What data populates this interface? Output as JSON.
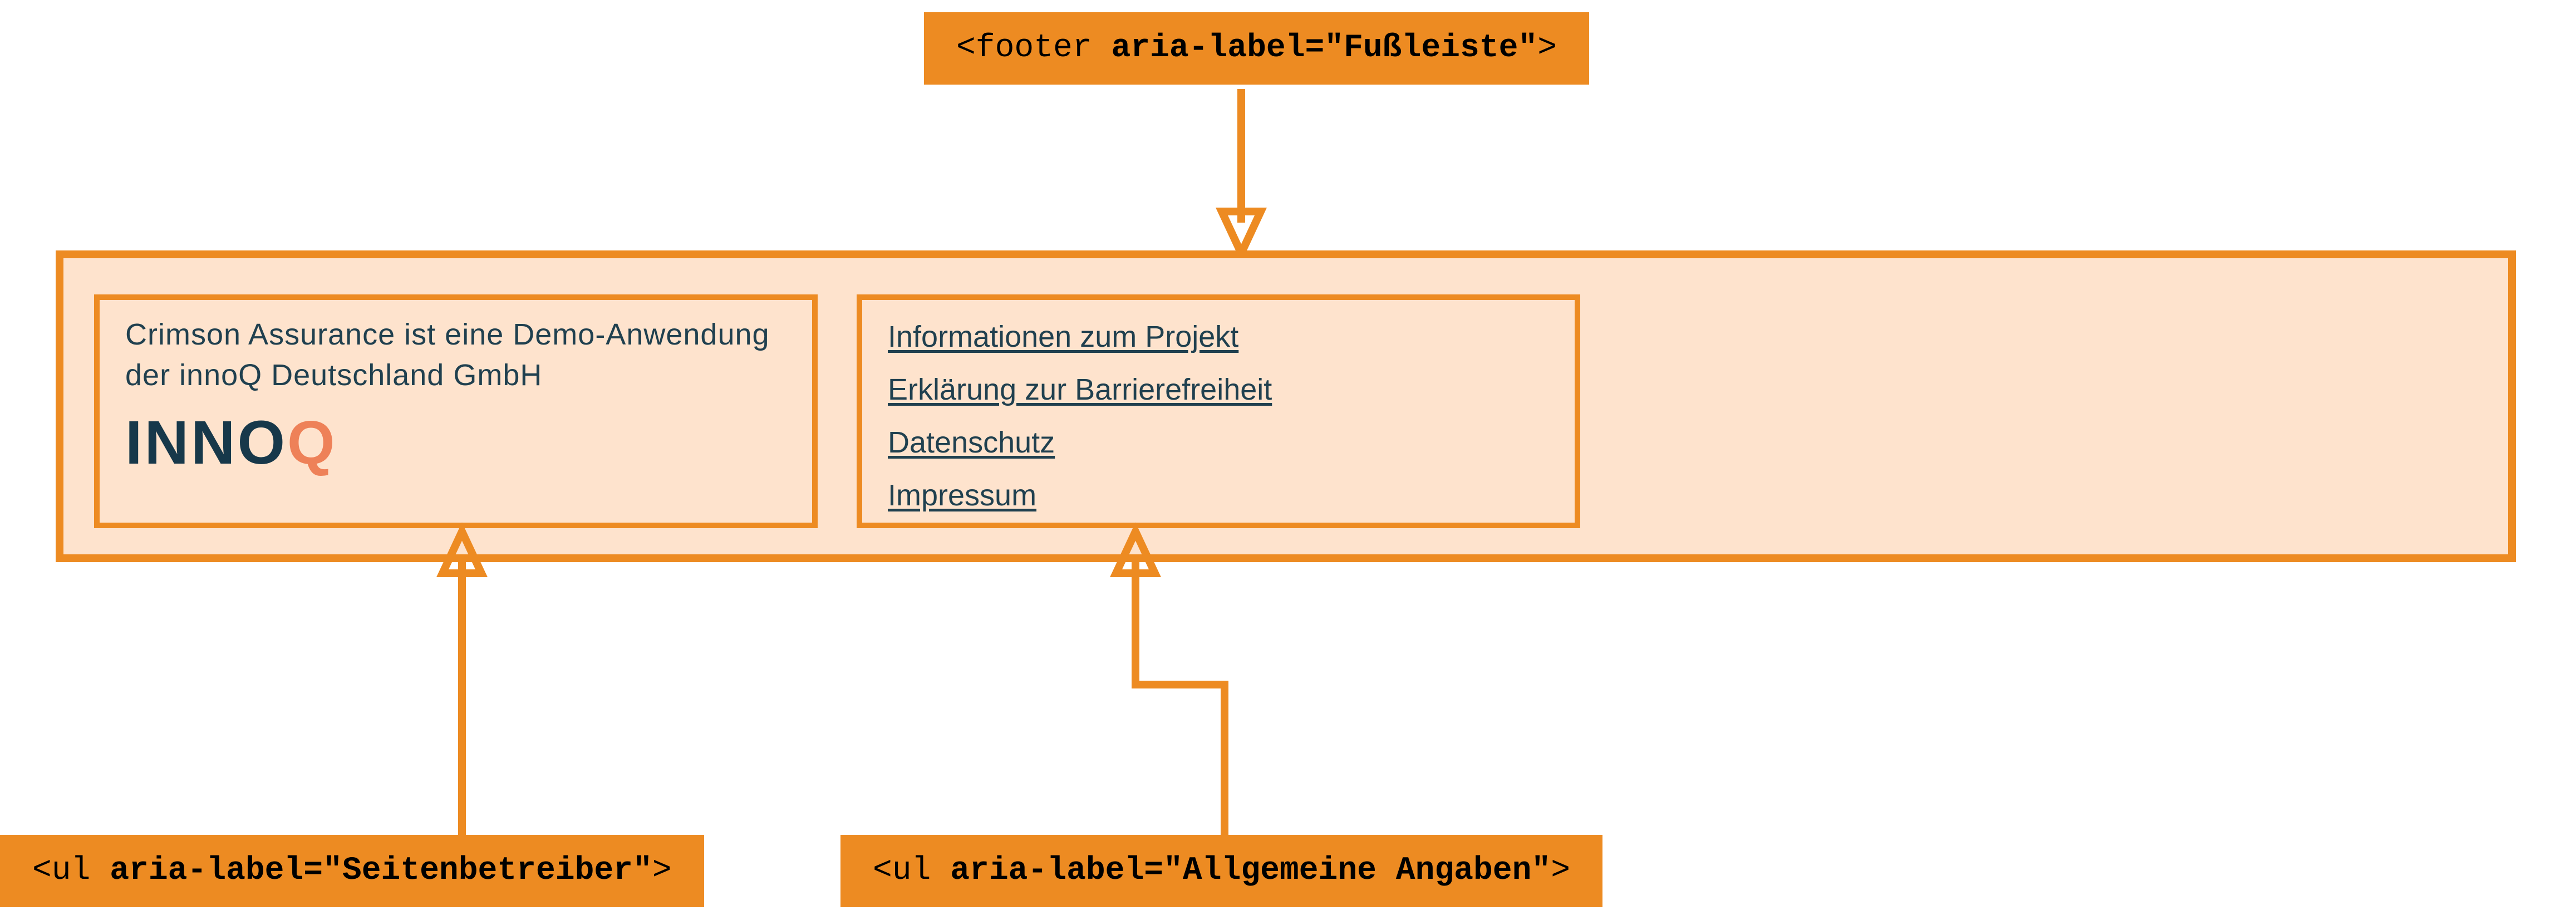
{
  "labels": {
    "top_pre": "<footer ",
    "top_bold": "aria-label=\"Fußleiste\"",
    "top_post": ">",
    "bl_pre": "<ul ",
    "bl_bold": "aria-label=\"Seitenbetreiber\"",
    "bl_post": ">",
    "br_pre": "<ul ",
    "br_bold": "aria-label=\"Allgemeine Angaben\"",
    "br_post": ">"
  },
  "footer": {
    "operator": {
      "description": "Crimson Assurance ist eine Demo-Anwendung der innoQ Deutschland GmbH",
      "logo_part1": "INNO",
      "logo_part2": "Q"
    },
    "links": [
      "Informationen zum Projekt",
      "Erklärung zur Barrierefreiheit",
      "Datenschutz",
      "Impressum"
    ]
  }
}
